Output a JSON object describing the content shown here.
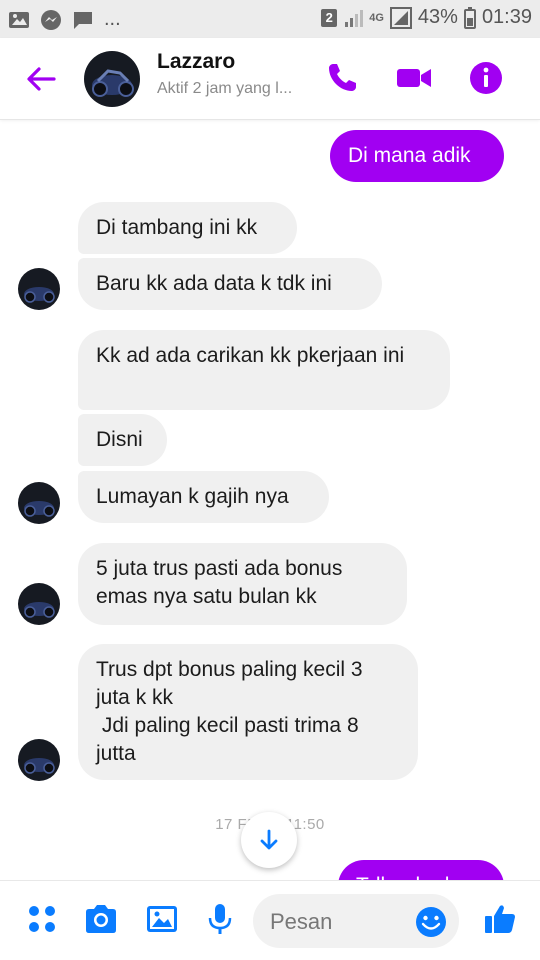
{
  "status_bar": {
    "notif_badge": "2",
    "network": "4G",
    "battery": "43%",
    "time": "01:39"
  },
  "header": {
    "contact_name": "Lazzaro",
    "contact_status": "Aktif 2 jam yang l..."
  },
  "messages": [
    {
      "id": "m1",
      "direction": "out",
      "text": "Di mana adik"
    },
    {
      "id": "m2",
      "direction": "in",
      "text": "Di tambang ini kk"
    },
    {
      "id": "m3",
      "direction": "in",
      "text": "Baru kk ada data k tdk ini"
    },
    {
      "id": "m4",
      "direction": "in",
      "text": "Kk ad ada carikan kk pkerjaan ini"
    },
    {
      "id": "m5",
      "direction": "in",
      "text": "Disni"
    },
    {
      "id": "m6",
      "direction": "in",
      "text": "Lumayan k gajih nya"
    },
    {
      "id": "m7",
      "direction": "in",
      "text": "5 juta   trus pasti ada bonus emas nya satu bulan   kk"
    },
    {
      "id": "m8",
      "direction": "in",
      "text": "Trus dpt bonus paling kecil 3 juta k kk\n Jdi paling kecil pasti trima 8 jutta"
    }
  ],
  "date_separator": "17 FEB      L 11:50",
  "partial_outgoing": "Tdk ada d",
  "composer": {
    "placeholder": "Pesan"
  },
  "colors": {
    "accent": "#a100f2",
    "incoming_bubble": "#f0f0f0",
    "composer_icons": "#0a7cff"
  }
}
